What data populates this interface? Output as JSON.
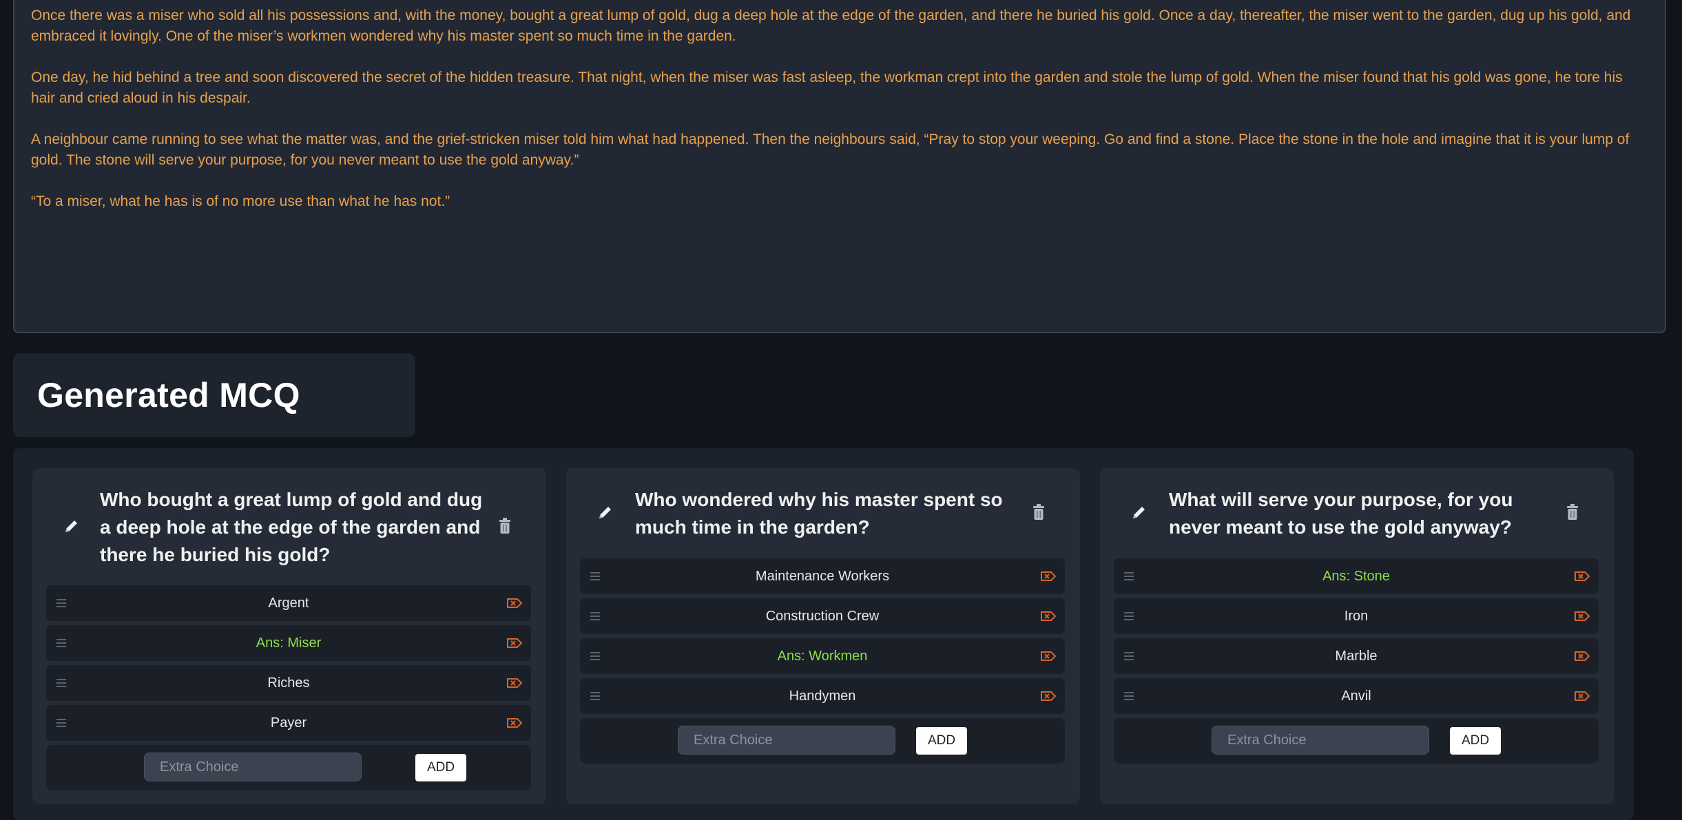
{
  "story": {
    "paragraphs": [
      "Once there was a miser who sold all his possessions and, with the money, bought a great lump of gold, dug a deep hole at the edge of the garden, and there he buried his gold. Once a day, thereafter, the miser went to the garden, dug up his gold, and embraced it lovingly. One of the miser’s workmen wondered why his master spent so much time in the garden.",
      "One day, he hid behind a tree and soon discovered the secret of the hidden treasure. That night, when the miser was fast asleep, the workman crept into the garden and stole the lump of gold. When the miser found that his gold was gone, he tore his hair and cried aloud in his despair.",
      "A neighbour came running to see what the matter was, and the grief-stricken miser told him what had happened. Then the neighbours said, “Pray to stop your weeping. Go and find a stone. Place the stone in the hole and imagine that it is your lump of gold. The stone will serve your purpose, for you never meant to use the gold anyway.”",
      "“To a miser, what he has is of no more use than what he has not.”"
    ]
  },
  "section_title": "Generated MCQ",
  "colors": {
    "story_text": "#e8a04e",
    "answer_text": "#8ee04a",
    "tag_icon": "#d9622b"
  },
  "cards": [
    {
      "question": "Who bought a great lump of gold and dug a deep hole at the edge of the garden and there he buried his gold?",
      "choices": [
        {
          "label": "Argent",
          "is_answer": false
        },
        {
          "label": "Ans: Miser",
          "is_answer": true
        },
        {
          "label": "Riches",
          "is_answer": false
        },
        {
          "label": "Payer",
          "is_answer": false
        }
      ],
      "extra_placeholder": "Extra Choice",
      "add_label": "ADD"
    },
    {
      "question": "Who wondered why his master spent so much time in the garden?",
      "choices": [
        {
          "label": "Maintenance Workers",
          "is_answer": false
        },
        {
          "label": "Construction Crew",
          "is_answer": false
        },
        {
          "label": "Ans: Workmen",
          "is_answer": true
        },
        {
          "label": "Handymen",
          "is_answer": false
        }
      ],
      "extra_placeholder": "Extra Choice",
      "add_label": "ADD"
    },
    {
      "question": "What will serve your purpose, for you never meant to use the gold anyway?",
      "choices": [
        {
          "label": "Ans: Stone",
          "is_answer": true
        },
        {
          "label": "Iron",
          "is_answer": false
        },
        {
          "label": "Marble",
          "is_answer": false
        },
        {
          "label": "Anvil",
          "is_answer": false
        }
      ],
      "extra_placeholder": "Extra Choice",
      "add_label": "ADD"
    }
  ],
  "icons": {
    "edit": "pencil-icon",
    "delete": "trash-icon",
    "drag": "drag-handle-icon",
    "remove": "tag-remove-icon"
  }
}
